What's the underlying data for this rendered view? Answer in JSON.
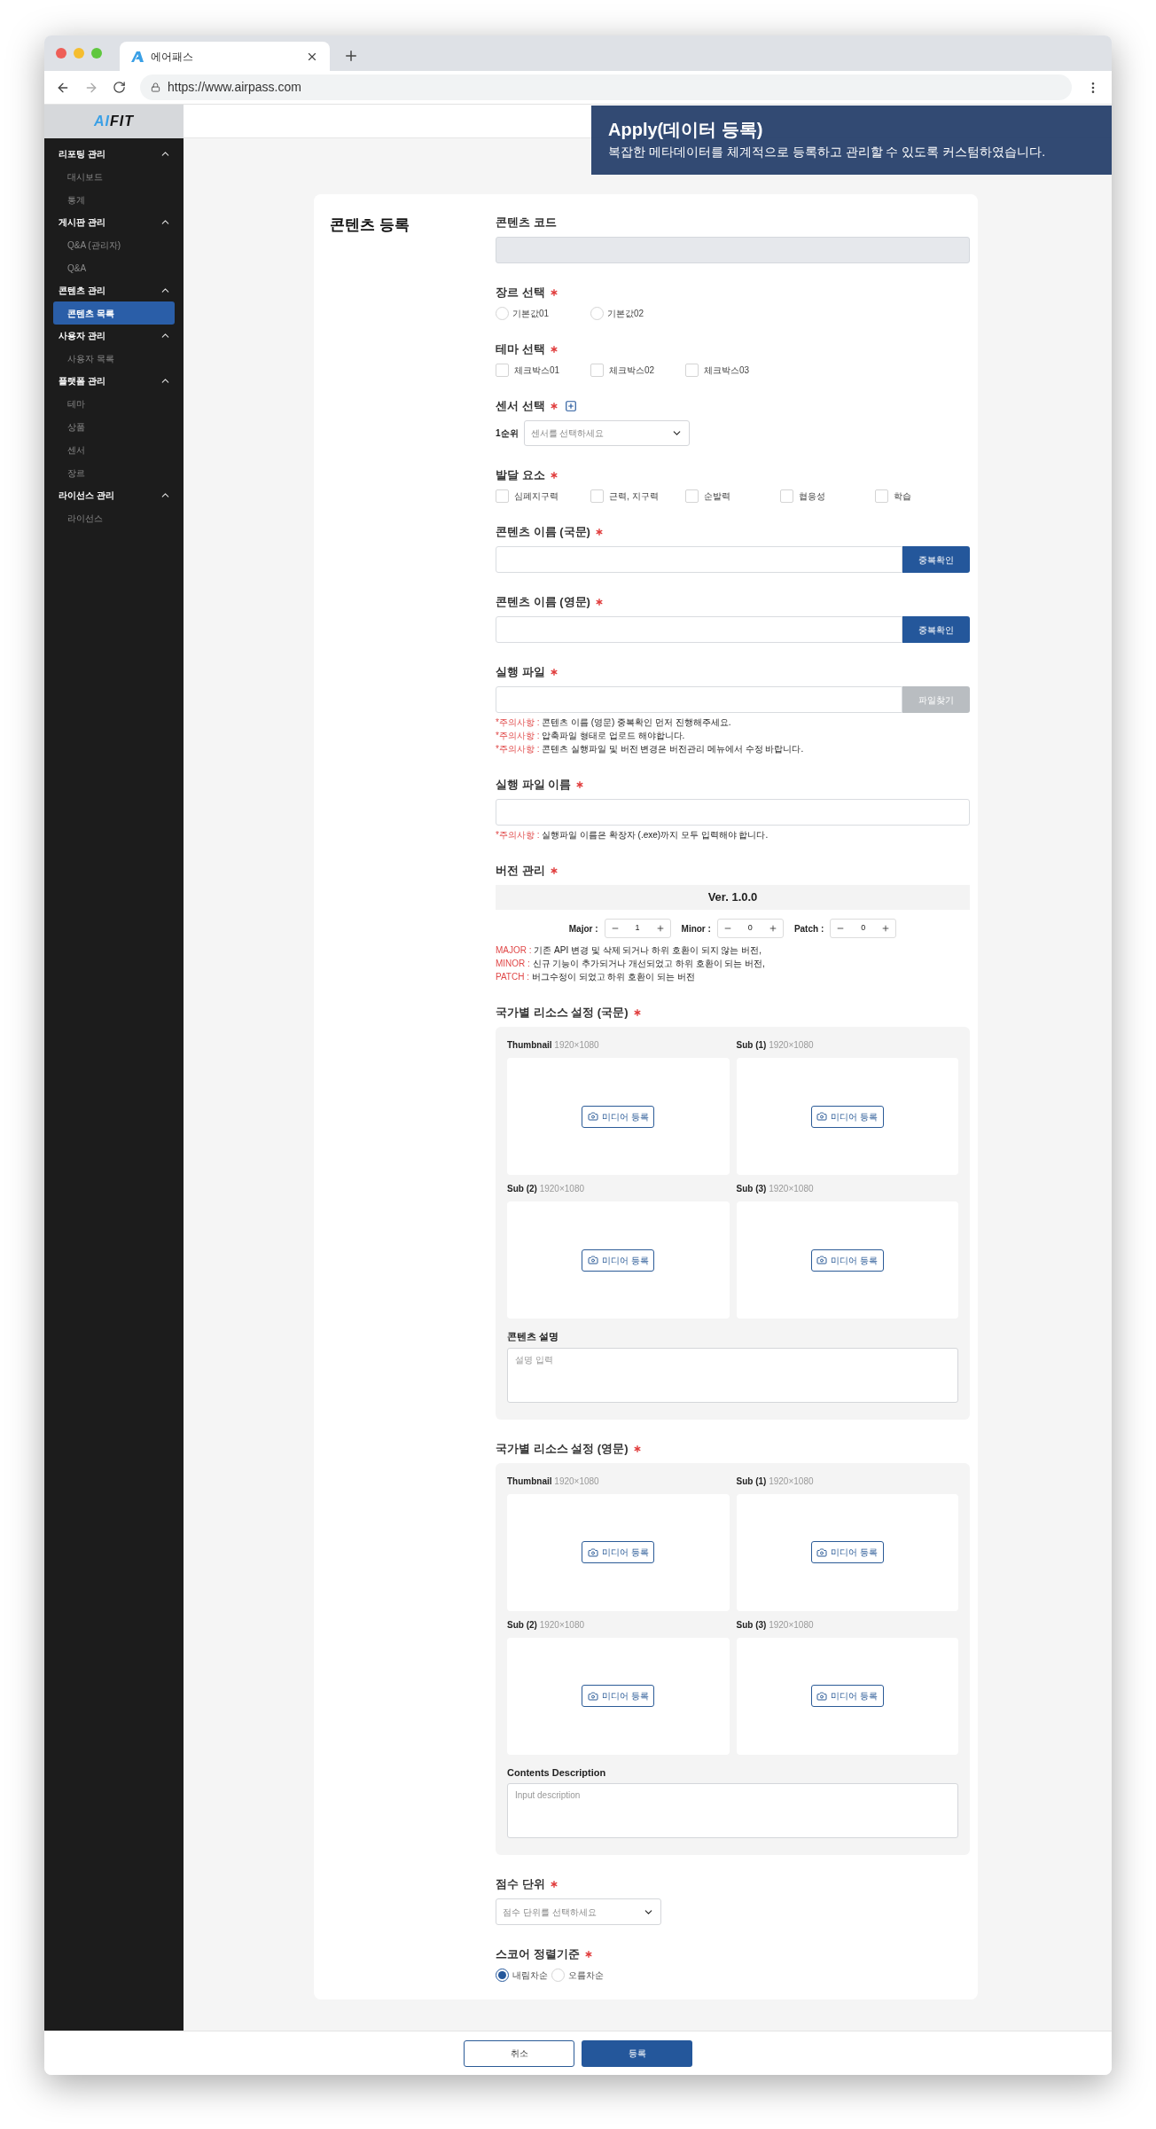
{
  "browser": {
    "tab_title": "에어패스",
    "url": "https://www.airpass.com"
  },
  "sidebar": {
    "logo": {
      "accent": "AI",
      "rest": "FIT"
    },
    "groups": [
      {
        "label": "리포팅 관리",
        "expanded": true,
        "items": [
          {
            "label": "대시보드",
            "selected": false
          },
          {
            "label": "통계",
            "selected": false
          }
        ]
      },
      {
        "label": "게시판 관리",
        "expanded": true,
        "items": [
          {
            "label": "Q&A (관리자)",
            "selected": false
          },
          {
            "label": "Q&A",
            "selected": false
          }
        ]
      },
      {
        "label": "콘텐츠 관리",
        "expanded": true,
        "items": [
          {
            "label": "콘텐츠 목록",
            "selected": true
          }
        ]
      },
      {
        "label": "사용자 관리",
        "expanded": true,
        "items": [
          {
            "label": "사용자 목록",
            "selected": false
          }
        ]
      },
      {
        "label": "플랫폼 관리",
        "expanded": true,
        "items": [
          {
            "label": "테마",
            "selected": false
          },
          {
            "label": "상품",
            "selected": false
          },
          {
            "label": "센서",
            "selected": false
          },
          {
            "label": "장르",
            "selected": false
          }
        ]
      },
      {
        "label": "라이선스 관리",
        "expanded": true,
        "items": [
          {
            "label": "라이선스",
            "selected": false
          }
        ]
      }
    ]
  },
  "banner": {
    "title": "Apply(데이터 등록)",
    "text": "복잡한 메타데이터를 체계적으로 등록하고 관리할 수 있도록 커스텀하였습니다."
  },
  "form": {
    "title": "콘텐츠 등록",
    "fields": [
      {
        "kind": "input",
        "label": "콘텐츠 코드",
        "disabled": true
      },
      {
        "kind": "radio",
        "label": "장르 선택",
        "required": true,
        "options": [
          {
            "label": "기본값01",
            "selected": false
          },
          {
            "label": "기본값02",
            "selected": false
          }
        ]
      },
      {
        "kind": "checkbox",
        "label": "테마 선택",
        "required": true,
        "options": [
          {
            "label": "체크박스01",
            "checked": false
          },
          {
            "label": "체크박스02",
            "checked": false
          },
          {
            "label": "체크박스03",
            "checked": false
          }
        ]
      },
      {
        "kind": "sensor",
        "label": "센서 선택",
        "required": true,
        "rank": "1순위",
        "placeholder": "센서를 선택하세요"
      },
      {
        "kind": "checkbox",
        "label": "발달 요소",
        "required": true,
        "options": [
          {
            "label": "심폐지구력",
            "checked": false
          },
          {
            "label": "근력, 지구력",
            "checked": false
          },
          {
            "label": "순발력",
            "checked": false
          },
          {
            "label": "협응성",
            "checked": false
          },
          {
            "label": "학습",
            "checked": false
          }
        ]
      },
      {
        "kind": "input",
        "label": "콘텐츠 이름 (국문)",
        "required": true,
        "disabled": false,
        "button": {
          "label": "중복확인",
          "disabled": false
        }
      },
      {
        "kind": "input",
        "label": "콘텐츠 이름 (영문)",
        "required": true,
        "disabled": false,
        "button": {
          "label": "중복확인",
          "disabled": false
        }
      },
      {
        "kind": "input",
        "label": "실행 파일",
        "required": true,
        "disabled": false,
        "button": {
          "label": "파일찾기",
          "disabled": true
        },
        "notes": [
          {
            "tag": "*주의사항 :",
            "text": "콘텐츠 이름 (영문) 중복확인 먼저 진행해주세요."
          },
          {
            "tag": "*주의사항 :",
            "text": "압축파일 형태로 업로드 해야합니다."
          },
          {
            "tag": "*주의사항 :",
            "text": "콘텐츠 실행파일 및 버전 변경은 버전관리 메뉴에서 수정 바랍니다."
          }
        ]
      },
      {
        "kind": "input",
        "label": "실행 파일 이름",
        "required": true,
        "disabled": false,
        "notes": [
          {
            "tag": "*주의사항 :",
            "text": "실행파일 이름은 확장자 (.exe)까지 모두 입력해야 합니다."
          }
        ]
      },
      {
        "kind": "version",
        "label": "버전 관리",
        "required": true,
        "version": "Ver. 1.0.0",
        "steppers": [
          {
            "label": "Major :",
            "value": "1"
          },
          {
            "label": "Minor :",
            "value": "0"
          },
          {
            "label": "Patch :",
            "value": "0"
          }
        ],
        "notes": [
          {
            "tag": "MAJOR :",
            "text": "기존 API 변경 및 삭제 되거나 하위 호환이 되지 않는 버전,"
          },
          {
            "tag": "MINOR :",
            "text": "신규 기능이 추가되거나 개선되었고 하위 호환이 되는 버전,"
          },
          {
            "tag": "PATCH :",
            "text": "버그수정이 되었고 하위 호환이 되는 버전"
          }
        ]
      },
      {
        "kind": "resources",
        "label": "국가별 리소스 설정 (국문)",
        "required": true,
        "slots": [
          {
            "name": "Thumbnail",
            "size": "1920×1080",
            "button": "미디어 등록"
          },
          {
            "name": "Sub (1)",
            "size": "1920×1080",
            "button": "미디어 등록"
          },
          {
            "name": "Sub (2)",
            "size": "1920×1080",
            "button": "미디어 등록"
          },
          {
            "name": "Sub (3)",
            "size": "1920×1080",
            "button": "미디어 등록"
          }
        ],
        "description_label": "콘텐츠 설명",
        "description_placeholder": "설명 입력"
      },
      {
        "kind": "resources",
        "label": "국가별 리소스 설정 (영문)",
        "required": true,
        "slots": [
          {
            "name": "Thumbnail",
            "size": "1920×1080",
            "button": "미디어 등록"
          },
          {
            "name": "Sub (1)",
            "size": "1920×1080",
            "button": "미디어 등록"
          },
          {
            "name": "Sub (2)",
            "size": "1920×1080",
            "button": "미디어 등록"
          },
          {
            "name": "Sub (3)",
            "size": "1920×1080",
            "button": "미디어 등록"
          }
        ],
        "description_label": "Contents Description",
        "description_placeholder": "Input description"
      },
      {
        "kind": "select",
        "label": "점수 단위",
        "required": true,
        "placeholder": "점수 단위를 선택하세요"
      },
      {
        "kind": "radio",
        "label": "스코어 정렬기준",
        "required": true,
        "compact": true,
        "options": [
          {
            "label": "내림차순",
            "selected": true
          },
          {
            "label": "오름차순",
            "selected": false
          }
        ]
      }
    ]
  },
  "footer": {
    "buttons": [
      {
        "label": "취소",
        "kind": "secondary"
      },
      {
        "label": "등록",
        "kind": "primary"
      }
    ]
  }
}
